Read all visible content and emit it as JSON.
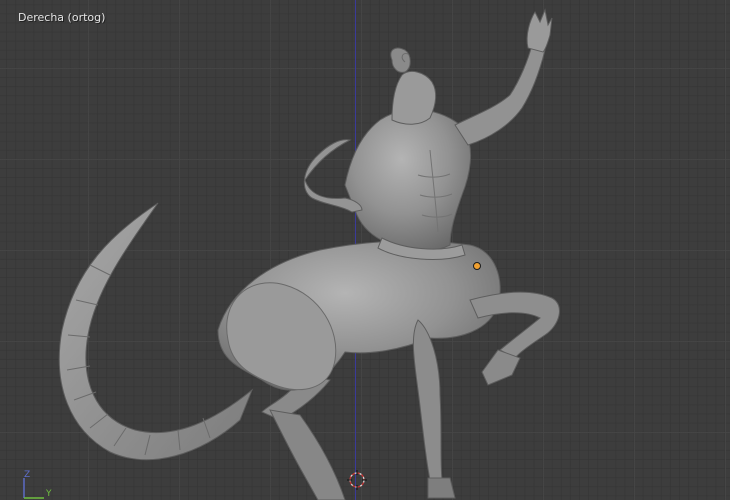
{
  "viewport": {
    "view_label": "Derecha (ortog)",
    "background_color": "#3d3d3d",
    "grid_color": "#464646",
    "z_axis_color": "#3a3a9a"
  },
  "model": {
    "color": "#8e8e8e"
  },
  "axis_gizmo": {
    "z_label": "Z",
    "y_label": "Y",
    "z_color": "#5f6fd0",
    "y_color": "#6fbf3f"
  },
  "icons": {
    "cursor": "3d-cursor-icon",
    "origin": "object-origin-icon"
  }
}
